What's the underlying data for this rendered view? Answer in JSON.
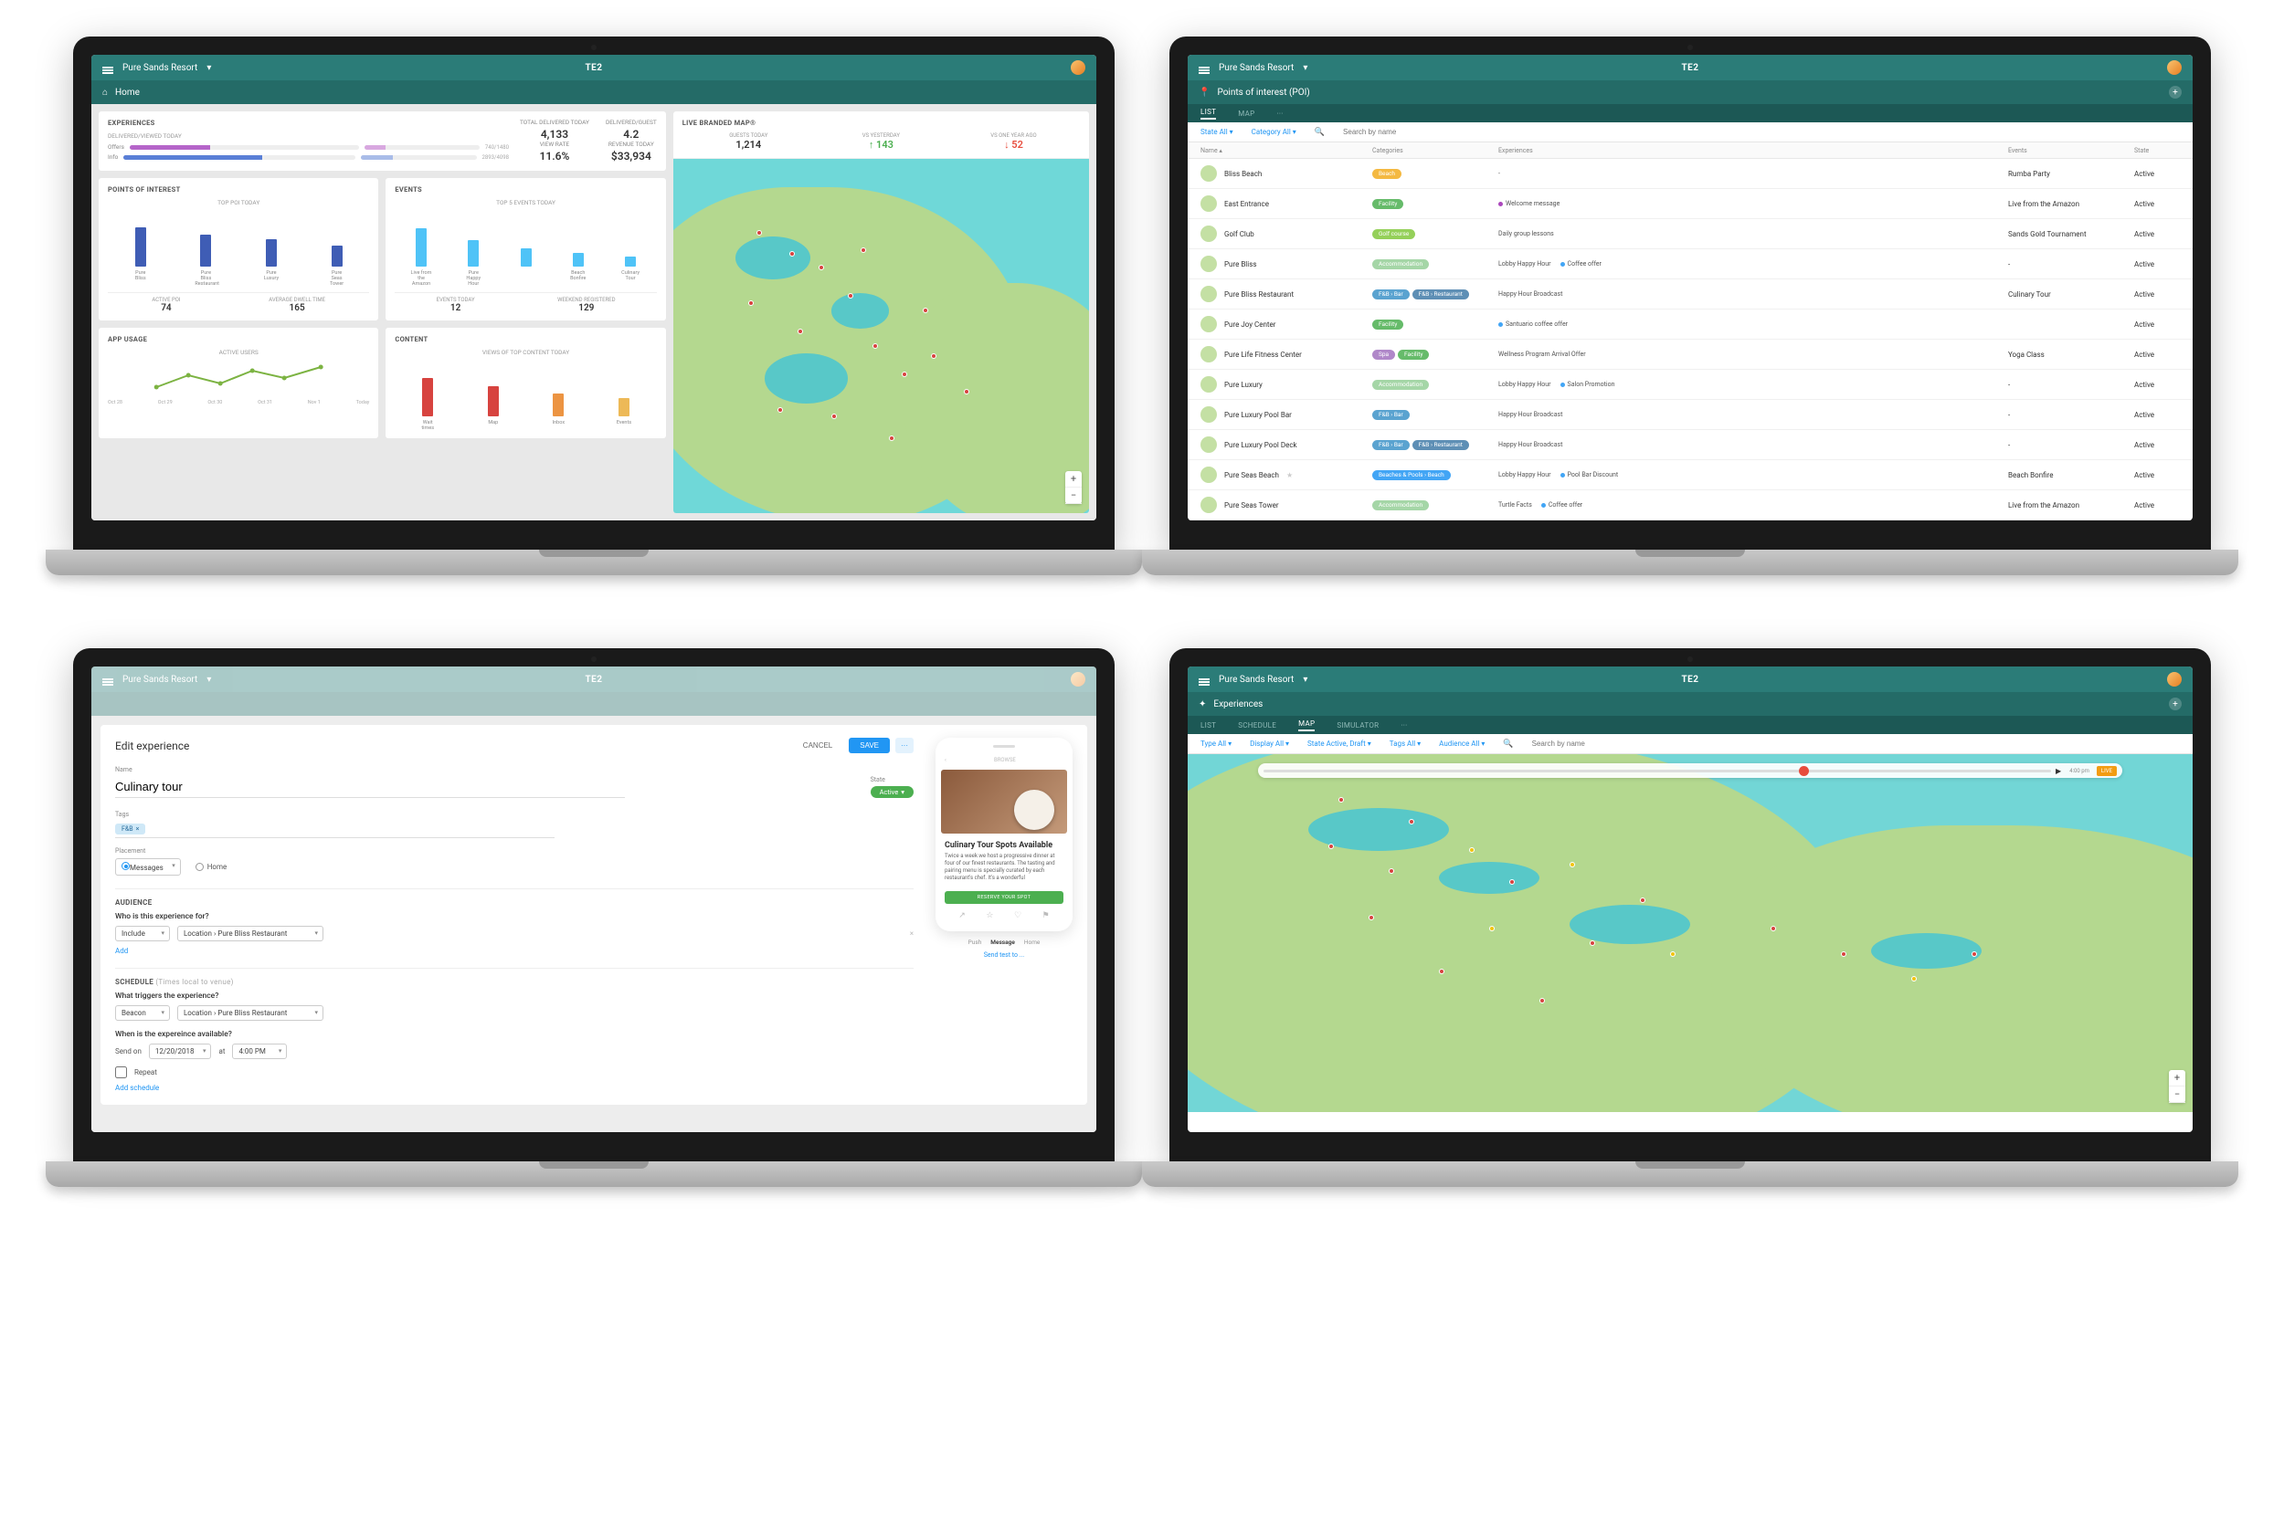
{
  "brand": "TE2",
  "resort": "Pure Sands Resort",
  "screens": {
    "dashboard": {
      "nav": {
        "home_icon": "home",
        "home_label": "Home"
      },
      "experiences": {
        "title": "EXPERIENCES",
        "sub": "DELIVERED/VIEWED TODAY",
        "rows": [
          {
            "label": "Offers",
            "pct1": 35,
            "pct2": 18,
            "color1": "#b565c9",
            "color2": "#d8a8e0",
            "n": "740/1480"
          },
          {
            "label": "Info",
            "pct1": 60,
            "pct2": 28,
            "color1": "#5a7fd6",
            "color2": "#a9bce8",
            "n": "2893/4098"
          }
        ],
        "stats": [
          {
            "label": "TOTAL DELIVERED TODAY",
            "value": "4,133"
          },
          {
            "label": "VIEW RATE",
            "value": "11.6%"
          },
          {
            "label": "DELIVERED/GUEST",
            "value": "4.2"
          },
          {
            "label": "REVENUE TODAY",
            "value": "$33,934"
          }
        ]
      },
      "poi": {
        "title": "POINTS OF INTEREST",
        "sub": "TOP POI TODAY",
        "bars": [
          {
            "label": "Pure Bliss",
            "h": 72
          },
          {
            "label": "Pure Bliss Restaurant",
            "h": 58
          },
          {
            "label": "Pure Luxury",
            "h": 50
          },
          {
            "label": "Pure Seas Tower",
            "h": 38
          }
        ],
        "kpis": [
          {
            "label": "ACTIVE POI",
            "value": "74"
          },
          {
            "label": "AVERAGE DWELL TIME",
            "value": "165"
          }
        ]
      },
      "events": {
        "title": "EVENTS",
        "sub": "TOP 5 EVENTS TODAY",
        "bars": [
          {
            "label": "Live from the Amazon",
            "h": 70
          },
          {
            "label": "Pure Happy Hour",
            "h": 48
          },
          {
            "label": "",
            "h": 34
          },
          {
            "label": "Beach Bonfire",
            "h": 25
          },
          {
            "label": "Culinary Tour",
            "h": 18
          }
        ],
        "kpis": [
          {
            "label": "EVENTS TODAY",
            "value": "12"
          },
          {
            "label": "WEEKEND REGISTERED",
            "value": "129"
          }
        ]
      },
      "app_usage": {
        "title": "APP USAGE",
        "sub": "ACTIVE USERS",
        "x": [
          "Oct 28",
          "Oct 29",
          "Oct 30",
          "Oct 31",
          "Nov 1",
          "Today"
        ],
        "y": [
          90,
          140,
          108,
          155,
          132,
          170
        ]
      },
      "content": {
        "title": "CONTENT",
        "sub": "VIEWS OF TOP CONTENT TODAY",
        "bars": [
          {
            "label": "Wait times",
            "h": 70,
            "cls": "rd"
          },
          {
            "label": "Map",
            "h": 56,
            "cls": "rd"
          },
          {
            "label": "Inbox",
            "h": 42,
            "cls": "or"
          },
          {
            "label": "Events",
            "h": 34,
            "cls": "yl"
          }
        ]
      },
      "map": {
        "title": "LIVE BRANDED MAP®",
        "stats": [
          {
            "label": "GUESTS TODAY",
            "value": "1,214",
            "cls": ""
          },
          {
            "label": "VS YESTERDAY",
            "value": "↑ 143",
            "cls": "gn"
          },
          {
            "label": "VS ONE YEAR AGO",
            "value": "↓ 52",
            "cls": "rd"
          }
        ]
      }
    },
    "poi": {
      "title": "Points of interest (POI)",
      "tabs": [
        "LIST",
        "MAP",
        "···"
      ],
      "filters": {
        "state": "State All ▾",
        "category": "Category All ▾",
        "search_placeholder": "Search by name"
      },
      "columns": [
        "Name ▴",
        "Categories",
        "Experiences",
        "Events",
        "State"
      ],
      "rows": [
        {
          "name": "Bliss Beach",
          "cats": [
            {
              "t": "Beach",
              "c": "beach"
            }
          ],
          "exps": [
            {
              "t": "-",
              "d": ""
            }
          ],
          "event": "Rumba Party",
          "state": "Active"
        },
        {
          "name": "East Entrance",
          "cats": [
            {
              "t": "Facility",
              "c": "fac"
            }
          ],
          "exps": [
            {
              "t": "Welcome message",
              "d": "p"
            }
          ],
          "event": "Live from the Amazon",
          "state": "Active"
        },
        {
          "name": "Golf Club",
          "cats": [
            {
              "t": "Golf course",
              "c": "golf"
            }
          ],
          "exps": [
            {
              "t": "Daily group lessons",
              "d": ""
            }
          ],
          "event": "Sands Gold Tournament",
          "state": "Active"
        },
        {
          "name": "Pure Bliss",
          "cats": [
            {
              "t": "Accommodation",
              "c": "acc"
            }
          ],
          "exps": [
            {
              "t": "Lobby Happy Hour",
              "d": ""
            },
            {
              "t": "Coffee offer",
              "d": "b"
            }
          ],
          "event": "-",
          "state": "Active"
        },
        {
          "name": "Pure Bliss Restaurant",
          "cats": [
            {
              "t": "F&B › Bar",
              "c": "fnb"
            },
            {
              "t": "F&B › Restaurant",
              "c": "rest"
            }
          ],
          "exps": [
            {
              "t": "Happy Hour Broadcast",
              "d": ""
            }
          ],
          "event": "Culinary Tour",
          "state": "Active"
        },
        {
          "name": "Pure Joy Center",
          "cats": [
            {
              "t": "Facility",
              "c": "fac"
            }
          ],
          "exps": [
            {
              "t": "Santuario coffee offer",
              "d": "b"
            }
          ],
          "event": "",
          "state": "Active"
        },
        {
          "name": "Pure Life Fitness Center",
          "cats": [
            {
              "t": "Spa",
              "c": "spa"
            },
            {
              "t": "Facility",
              "c": "fac"
            }
          ],
          "exps": [
            {
              "t": "Wellness Program Arrival Offer",
              "d": ""
            }
          ],
          "event": "Yoga Class",
          "state": "Active"
        },
        {
          "name": "Pure Luxury",
          "cats": [
            {
              "t": "Accommodation",
              "c": "acc"
            }
          ],
          "exps": [
            {
              "t": "Lobby Happy Hour",
              "d": ""
            },
            {
              "t": "Salon Promotion",
              "d": "b"
            }
          ],
          "event": "-",
          "state": "Active"
        },
        {
          "name": "Pure Luxury Pool Bar",
          "cats": [
            {
              "t": "F&B › Bar",
              "c": "fnb"
            }
          ],
          "exps": [
            {
              "t": "Happy Hour Broadcast",
              "d": ""
            }
          ],
          "event": "-",
          "state": "Active"
        },
        {
          "name": "Pure Luxury Pool Deck",
          "cats": [
            {
              "t": "F&B › Bar",
              "c": "fnb"
            },
            {
              "t": "F&B › Restaurant",
              "c": "rest"
            }
          ],
          "exps": [
            {
              "t": "Happy Hour Broadcast",
              "d": ""
            }
          ],
          "event": "-",
          "state": "Active"
        },
        {
          "name": "Pure Seas Beach",
          "fav": "★",
          "cats": [
            {
              "t": "Beaches & Pools › Beach",
              "c": "bp"
            }
          ],
          "exps": [
            {
              "t": "Lobby Happy Hour",
              "d": ""
            },
            {
              "t": "Pool Bar Discount",
              "d": "b"
            }
          ],
          "event": "Beach Bonfire",
          "state": "Active"
        },
        {
          "name": "Pure Seas Tower",
          "cats": [
            {
              "t": "Accommodation",
              "c": "acc"
            }
          ],
          "exps": [
            {
              "t": "Turtle Facts",
              "d": ""
            },
            {
              "t": "Coffee offer",
              "d": "b"
            }
          ],
          "event": "Live from the Amazon",
          "state": "Active"
        }
      ]
    },
    "edit": {
      "heading": "Edit experience",
      "cancel": "CANCEL",
      "save": "SAVE",
      "more": "···",
      "name_label": "Name",
      "name_value": "Culinary tour",
      "state_label": "State",
      "state_value": "Active",
      "tags_label": "Tags",
      "tag": "F&B",
      "placement_label": "Placement",
      "placement_opts": [
        "Messages",
        "Home"
      ],
      "placement_sel": 0,
      "audience": {
        "section": "AUDIENCE",
        "q": "Who is this experience for?",
        "include": "Include",
        "loc": "Location › Pure Bliss Restaurant",
        "add": "Add"
      },
      "schedule": {
        "section": "SCHEDULE",
        "note": "(Times local to venue)",
        "q1": "What triggers the experience?",
        "trigger": "Beacon",
        "loc": "Location › Pure Bliss Restaurant",
        "q2": "When is the expereince available?",
        "send_on": "Send on",
        "date": "12/20/2018",
        "at": "at",
        "time": "4:00 PM",
        "repeat": "Repeat",
        "add_schedule": "Add schedule"
      },
      "phone": {
        "back": "‹",
        "top": "BROWSE",
        "title": "Culinary Tour Spots Available",
        "body": "Twice a week we host a progressive dinner at four of our finest restaurants. The tasting and pairing menu is specially curated by each restaurant's chef. It's a wonderful",
        "cta": "RESERVE YOUR SPOT",
        "tabs": [
          "Push",
          "Message",
          "Home"
        ],
        "tabs_sel": 1,
        "send": "Send test to ..."
      }
    },
    "experiences": {
      "title": "Experiences",
      "tabs": [
        "LIST",
        "SCHEDULE",
        "MAP",
        "SIMULATOR",
        "···"
      ],
      "filters": {
        "type": "Type All ▾",
        "display": "Display All ▾",
        "state": "State Active, Draft ▾",
        "tags": "Tags All ▾",
        "audience": "Audience All ▾",
        "search_placeholder": "Search by name"
      },
      "timeline": {
        "time": "4:00 pm",
        "live": "LIVE"
      }
    }
  },
  "chart_data": [
    {
      "type": "bar",
      "title": "TOP POI TODAY",
      "categories": [
        "Pure Bliss",
        "Pure Bliss Restaurant",
        "Pure Luxury",
        "Pure Seas Tower"
      ],
      "values": [
        72,
        58,
        50,
        38
      ],
      "ylim": [
        0,
        80
      ]
    },
    {
      "type": "bar",
      "title": "TOP 5 EVENTS TODAY",
      "categories": [
        "Live from the Amazon",
        "Pure Happy Hour",
        "",
        "Beach Bonfire",
        "Culinary Tour"
      ],
      "values": [
        70,
        48,
        34,
        25,
        18
      ],
      "ylim": [
        0,
        80
      ]
    },
    {
      "type": "line",
      "title": "ACTIVE USERS",
      "x": [
        "Oct 28",
        "Oct 29",
        "Oct 30",
        "Oct 31",
        "Nov 1",
        "Today"
      ],
      "values": [
        90,
        140,
        108,
        155,
        132,
        170
      ],
      "ylim": [
        50,
        200
      ]
    },
    {
      "type": "bar",
      "title": "VIEWS OF TOP CONTENT TODAY",
      "categories": [
        "Wait times",
        "Map",
        "Inbox",
        "Events"
      ],
      "values": [
        70,
        56,
        42,
        34
      ],
      "ylim": [
        0,
        80
      ]
    }
  ]
}
